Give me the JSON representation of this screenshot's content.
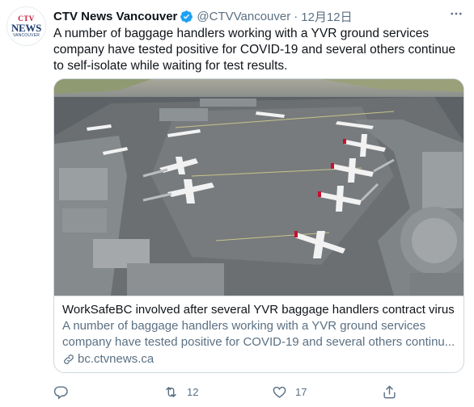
{
  "account": {
    "display_name": "CTV News Vancouver",
    "handle": "@CTVVancouver",
    "separator": "·",
    "timestamp": "12月12日",
    "verified": true,
    "avatar_logo": {
      "top": "CTV",
      "middle": "NEWS",
      "bottom": "VANCOUVER"
    }
  },
  "tweet": {
    "text": "A number of baggage handlers working with a YVR ground services company have tested positive for COVID-19 and several others continue to self-isolate while waiting for test results."
  },
  "card": {
    "title": "WorkSafeBC involved after several YVR baggage handlers contract virus",
    "description_line1": "A number of baggage handlers working with a YVR ground services",
    "description_line2": "company have tested positive for COVID-19 and several others continu...",
    "domain": "bc.ctvnews.ca"
  },
  "actions": {
    "reply_count": "",
    "retweet_count": "12",
    "like_count": "17"
  },
  "colors": {
    "primary_text": "#0f1419",
    "secondary_text": "#5b7083",
    "verified_blue": "#1da1f2",
    "border": "#cfd9de"
  },
  "icons": [
    "more-icon",
    "verified-badge-icon",
    "link-icon",
    "reply-icon",
    "retweet-icon",
    "like-icon",
    "share-icon"
  ]
}
